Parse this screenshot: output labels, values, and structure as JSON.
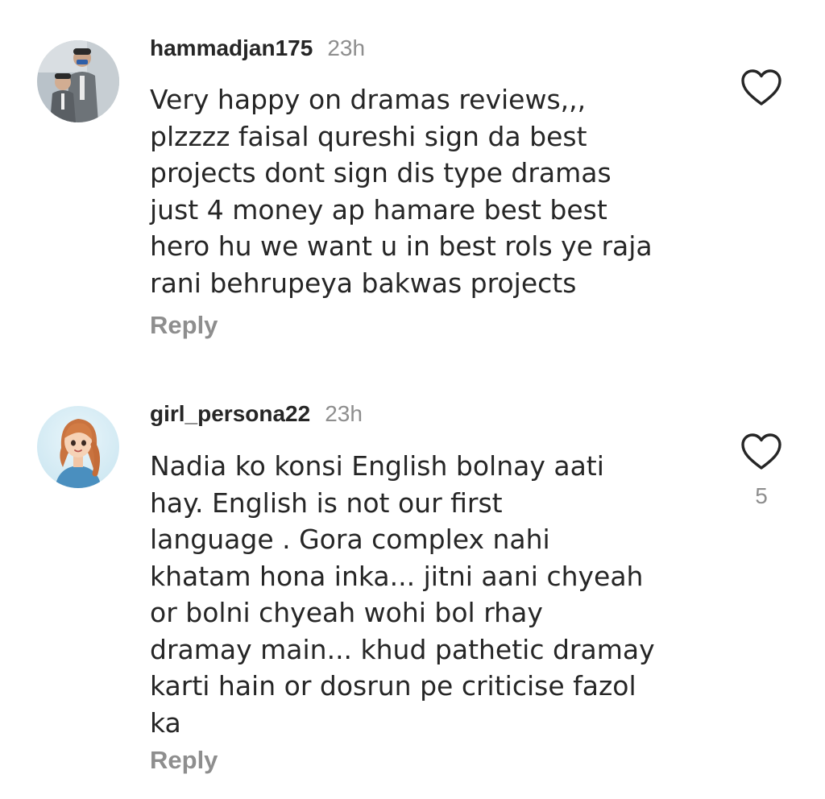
{
  "comments": [
    {
      "username": "hammadjan175",
      "time": "23h",
      "text": "Very happy on dramas reviews,,,\nplzzzz faisal qureshi sign da best\nprojects dont sign dis type dramas\njust 4 money ap hamare best best\nhero hu we want u in best rols ye raja\nrani behrupeya bakwas projects",
      "reply_label": "Reply",
      "like_icon": "heart-outline-icon",
      "like_count": ""
    },
    {
      "username": "girl_persona22",
      "time": "23h",
      "text": "Nadia ko konsi English bolnay aati\nhay. English is not our first\nlanguage . Gora complex nahi\nkhatam hona inka... jitni aani chyeah\nor bolni chyeah wohi bol rhay\ndramay main... khud pathetic dramay\nkarti hain or dosrun pe criticise fazol\nka",
      "reply_label": "Reply",
      "like_icon": "heart-outline-icon",
      "like_count": "5"
    }
  ],
  "colors": {
    "text_primary": "#262626",
    "text_secondary": "#8e8e8e",
    "background": "#ffffff"
  }
}
